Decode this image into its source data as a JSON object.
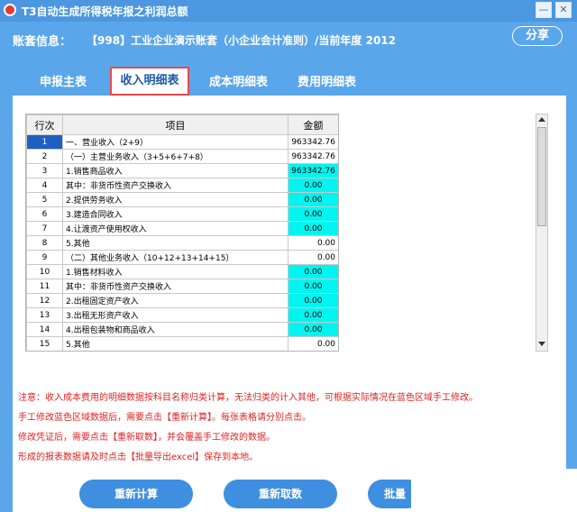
{
  "window": {
    "title": "T3自动生成所得税年报之利润总额",
    "minimize_glyph": "—",
    "close_glyph": "✕"
  },
  "header": {
    "account_label": "账套信息：",
    "account_info": "【998】工业企业演示账套（小企业会计准则）/当前年度 2012",
    "share_label": "分享"
  },
  "tabs": [
    {
      "label": "申报主表",
      "active": false
    },
    {
      "label": "收入明细表",
      "active": true
    },
    {
      "label": "成本明细表",
      "active": false
    },
    {
      "label": "费用明细表",
      "active": false
    }
  ],
  "table": {
    "headers": [
      "行次",
      "项目",
      "金额"
    ],
    "rows": [
      {
        "no": "1",
        "item": "一、营业收入（2+9）",
        "amount": "963342.76",
        "editable": false
      },
      {
        "no": "2",
        "item": "（一）主营业务收入（3+5+6+7+8）",
        "amount": "963342.76",
        "editable": false
      },
      {
        "no": "3",
        "item": "1.销售商品收入",
        "amount": "963342.76",
        "editable": true
      },
      {
        "no": "4",
        "item": "其中：非货币性资产交换收入",
        "amount": "0.00",
        "editable": true
      },
      {
        "no": "5",
        "item": "2.提供劳务收入",
        "amount": "0.00",
        "editable": true
      },
      {
        "no": "6",
        "item": "3.建造合同收入",
        "amount": "0.00",
        "editable": true
      },
      {
        "no": "7",
        "item": "4.让渡资产使用权收入",
        "amount": "0.00",
        "editable": true
      },
      {
        "no": "8",
        "item": "5.其他",
        "amount": "0.00",
        "editable": false
      },
      {
        "no": "9",
        "item": "（二）其他业务收入（10+12+13+14+15）",
        "amount": "0.00",
        "editable": false
      },
      {
        "no": "10",
        "item": "1.销售材料收入",
        "amount": "0.00",
        "editable": true
      },
      {
        "no": "11",
        "item": "其中：非货币性资产交换收入",
        "amount": "0.00",
        "editable": true
      },
      {
        "no": "12",
        "item": "2.出租固定资产收入",
        "amount": "0.00",
        "editable": true
      },
      {
        "no": "13",
        "item": "3.出租无形资产收入",
        "amount": "0.00",
        "editable": true
      },
      {
        "no": "14",
        "item": "4.出租包装物和商品收入",
        "amount": "0.00",
        "editable": true
      },
      {
        "no": "15",
        "item": "5.其他",
        "amount": "0.00",
        "editable": false
      }
    ]
  },
  "notes": [
    "注意：收入成本费用的明细数据按科目名称归类计算，无法归类的计入其他，可根据实际情况在蓝色区域手工修改。",
    "手工修改蓝色区域数据后，需要点击【重新计算】。每张表格请分别点击。",
    "修改凭证后，需要点击【重新取数】，并会覆盖手工修改的数据。",
    "形成的报表数据请及时点击【批量导出excel】保存到本地。"
  ],
  "buttons": {
    "recalc": "重新计算",
    "refetch": "重新取数",
    "batch": "批量"
  },
  "colors": {
    "frame": "#5aa6ea",
    "editable_cell": "#00f5f0",
    "selected_row_no": "#1f5ec2",
    "note_text": "#e02020",
    "pill_button": "#3f8fe0"
  }
}
